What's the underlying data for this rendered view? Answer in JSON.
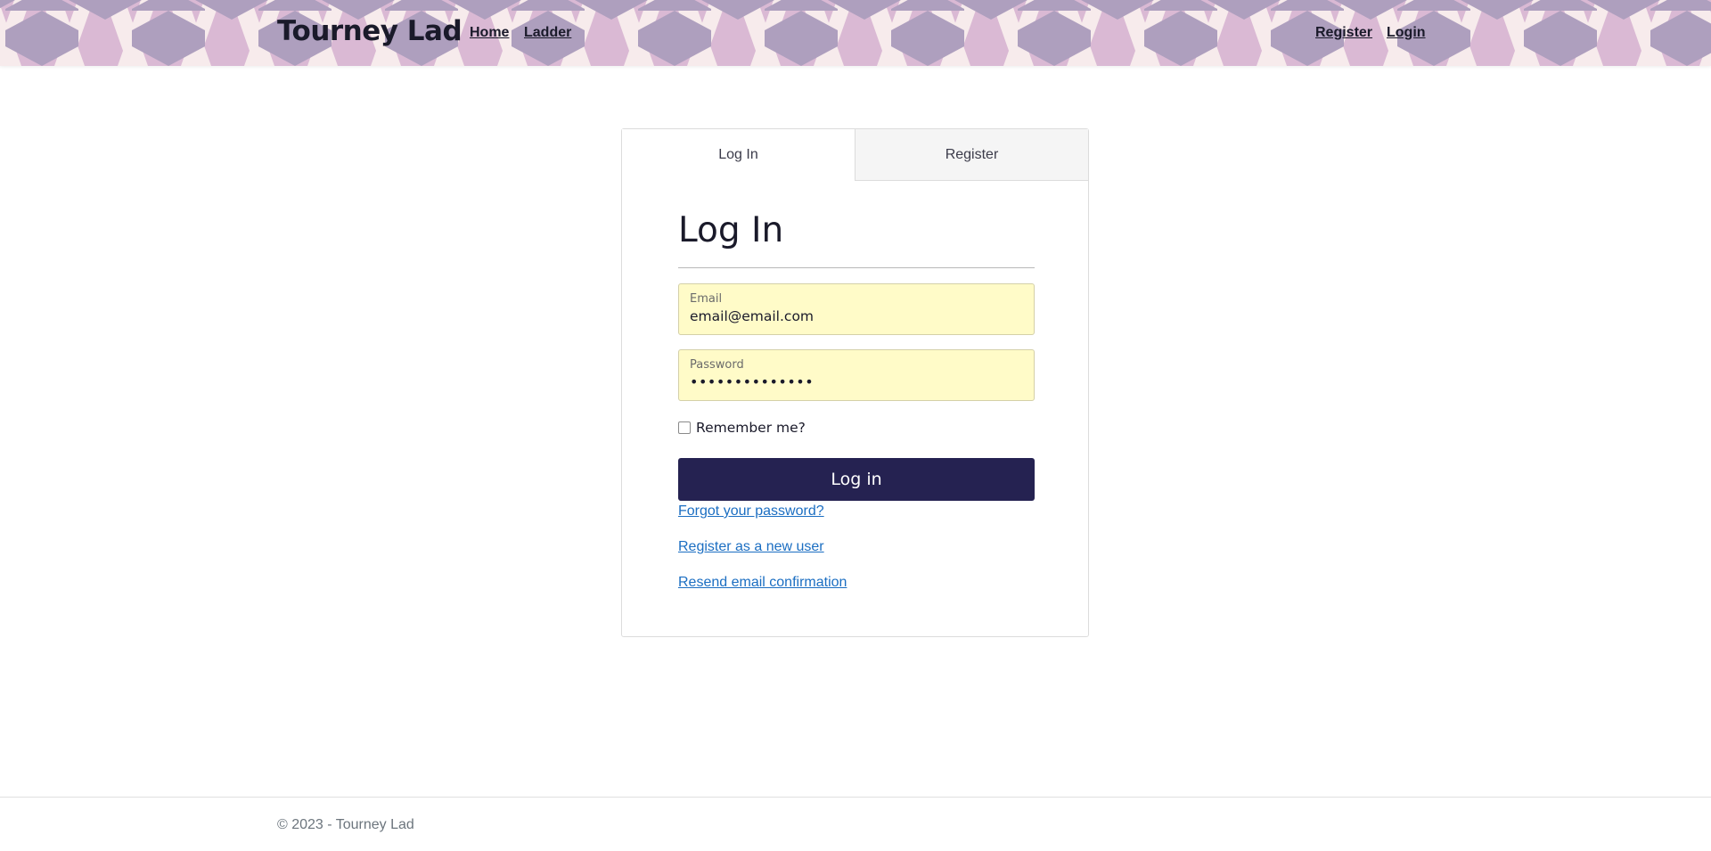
{
  "header": {
    "brand": "Tourney Lad",
    "nav_left": [
      {
        "label": "Home"
      },
      {
        "label": "Ladder"
      }
    ],
    "nav_right": [
      {
        "label": "Register"
      },
      {
        "label": "Login"
      }
    ],
    "pattern_colors": {
      "light": "#f7ebec",
      "pink": "#dab9d4",
      "purple": "#ae9fbe"
    }
  },
  "card": {
    "tabs": [
      {
        "label": "Log In",
        "active": true
      },
      {
        "label": "Register",
        "active": false
      }
    ],
    "title": "Log In",
    "email": {
      "label": "Email",
      "value": "email@email.com"
    },
    "password": {
      "label": "Password",
      "value": "••••••••••••••"
    },
    "remember": {
      "label": "Remember me?",
      "checked": false
    },
    "submit_label": "Log in",
    "links": {
      "forgot": "Forgot your password?",
      "register": "Register as a new user",
      "resend": "Resend email confirmation"
    }
  },
  "footer": {
    "text": "© 2023 - Tourney Lad"
  },
  "colors": {
    "primary_button": "#252251",
    "link": "#1b6ec2",
    "autofill_bg": "#fffbc8",
    "muted_text": "#6c757d"
  }
}
